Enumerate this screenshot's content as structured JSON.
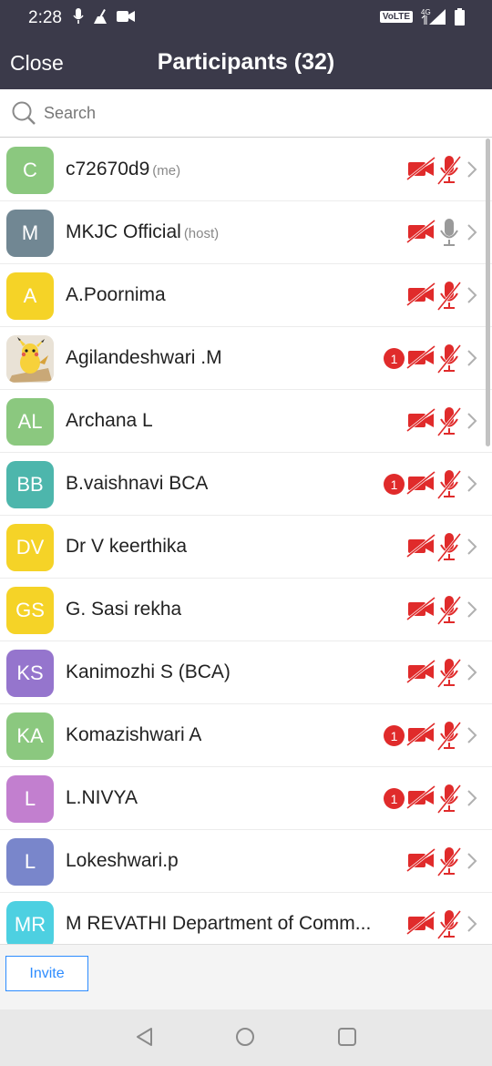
{
  "status_bar": {
    "time": "2:28",
    "network": "VoLTE",
    "signal": "4G"
  },
  "header": {
    "close_label": "Close",
    "title": "Participants (32)"
  },
  "search": {
    "placeholder": "Search"
  },
  "participants": [
    {
      "initials": "C",
      "avatar_color": "#8bc87f",
      "name": "c72670d9",
      "tag": "(me)",
      "badge": "",
      "video": "off",
      "audio": "muted"
    },
    {
      "initials": "M",
      "avatar_color": "#718793",
      "name": "MKJC Official",
      "tag": "(host)",
      "badge": "",
      "video": "off",
      "audio": "unmuted"
    },
    {
      "initials": "A",
      "avatar_color": "#f5d327",
      "name": "A.Poornima",
      "tag": "",
      "badge": "",
      "video": "off",
      "audio": "muted"
    },
    {
      "initials": "",
      "avatar_color": "#e8e8e8",
      "avatar_icon": "pikachu-avatar-image",
      "name": "Agilandeshwari .M",
      "tag": "",
      "badge": "1",
      "video": "off",
      "audio": "muted"
    },
    {
      "initials": "AL",
      "avatar_color": "#8bc87f",
      "name": "Archana L",
      "tag": "",
      "badge": "",
      "video": "off",
      "audio": "muted"
    },
    {
      "initials": "BB",
      "avatar_color": "#4db6ac",
      "name": "B.vaishnavi BCA",
      "tag": "",
      "badge": "1",
      "video": "off",
      "audio": "muted"
    },
    {
      "initials": "DV",
      "avatar_color": "#f5d327",
      "name": "Dr V keerthika",
      "tag": "",
      "badge": "",
      "video": "off",
      "audio": "muted"
    },
    {
      "initials": "GS",
      "avatar_color": "#f5d327",
      "name": "G. Sasi rekha",
      "tag": "",
      "badge": "",
      "video": "off",
      "audio": "muted"
    },
    {
      "initials": "KS",
      "avatar_color": "#9575cd",
      "name": "Kanimozhi S (BCA)",
      "tag": "",
      "badge": "",
      "video": "off",
      "audio": "muted"
    },
    {
      "initials": "KA",
      "avatar_color": "#8bc87f",
      "name": "Komazishwari A",
      "tag": "",
      "badge": "1",
      "video": "off",
      "audio": "muted"
    },
    {
      "initials": "L",
      "avatar_color": "#c27fcf",
      "name": "L.NIVYA",
      "tag": "",
      "badge": "1",
      "video": "off",
      "audio": "muted"
    },
    {
      "initials": "L",
      "avatar_color": "#7986cb",
      "name": "Lokeshwari.p",
      "tag": "",
      "badge": "",
      "video": "off",
      "audio": "muted"
    },
    {
      "initials": "MR",
      "avatar_color": "#4dd0e1",
      "name": "M REVATHI Department of Comm...",
      "tag": "",
      "badge": "",
      "video": "off",
      "audio": "muted"
    }
  ],
  "footer": {
    "invite_label": "Invite"
  },
  "colors": {
    "header_bg": "#3b3a4a",
    "muted_red": "#e02b2b",
    "accent_blue": "#2d8cff"
  }
}
